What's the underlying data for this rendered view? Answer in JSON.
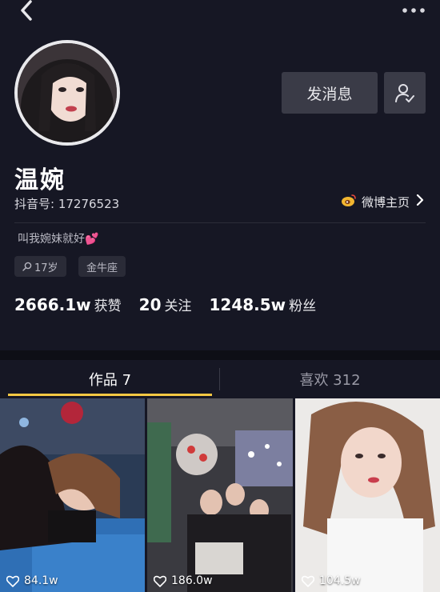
{
  "header": {
    "back_icon": "chevron-left-icon",
    "more_icon": "more-horizontal-icon"
  },
  "profile": {
    "name": "温婉",
    "douyin_id": "抖音号: 17276523",
    "weibo_link": "微博主页",
    "bio": "叫我婉妹就好",
    "bio_emoji": "💕",
    "tags": [
      "17岁",
      "金牛座"
    ]
  },
  "actions": {
    "message_label": "发消息",
    "follow_icon": "add-user-icon"
  },
  "stats": [
    {
      "value": "2666.1w",
      "label": "获赞"
    },
    {
      "value": "20",
      "label": "关注"
    },
    {
      "value": "1248.5w",
      "label": "粉丝"
    }
  ],
  "tabs": [
    {
      "label": "作品 7",
      "active": true
    },
    {
      "label": "喜欢 312",
      "active": false
    }
  ],
  "videos": [
    {
      "likes": "84.1w"
    },
    {
      "likes": "186.0w"
    },
    {
      "likes": "104.5w"
    }
  ],
  "colors": {
    "background": "#161724",
    "accent_underline": "#f7c843",
    "button_bg": "#3a3b47"
  }
}
